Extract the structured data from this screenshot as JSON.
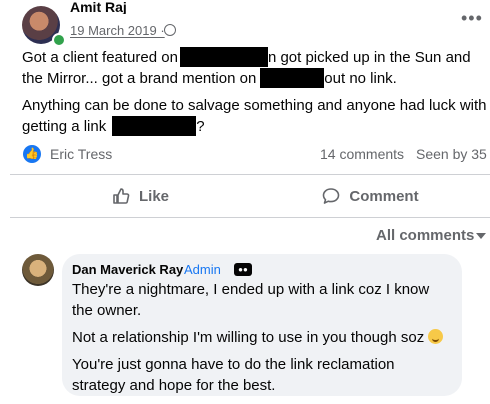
{
  "post": {
    "author": "Amit Raj",
    "date": "19 March 2019 ·",
    "text_line1_a": "Got a client featured on",
    "text_line1_b": "n got picked up in the Sun and",
    "text_line2_a": "the Mirror... got a brand mention on",
    "text_line2_b": "out no link.",
    "text_line3": "Anything can be done to salvage something and anyone had luck with",
    "text_line4": "getting a link",
    "text_line4_end": "?"
  },
  "stats": {
    "reactor": "Eric Tress",
    "comments": "14 comments",
    "seen_by": "Seen by 35"
  },
  "actions": {
    "like": "Like",
    "comment": "Comment",
    "all_comments": "All comments"
  },
  "comment": {
    "author": "Dan Maverick Ray",
    "badge": "Admin",
    "line1": "They're a nightmare, I ended up with a link coz I know",
    "line2": "the owner.",
    "line3": "Not a relationship I'm willing to use in you though soz",
    "line4": "You're just gonna have to do the link reclamation",
    "line5": "strategy and hope for the best."
  },
  "icons": {
    "reaction": "like-reaction-icon",
    "like": "thumbs-up-icon",
    "comment": "speech-bubble-icon",
    "more": "more-horizontal-icon"
  },
  "colors": {
    "accent": "#1877f2",
    "muted": "#65676b",
    "bubble": "#f0f2f5"
  }
}
